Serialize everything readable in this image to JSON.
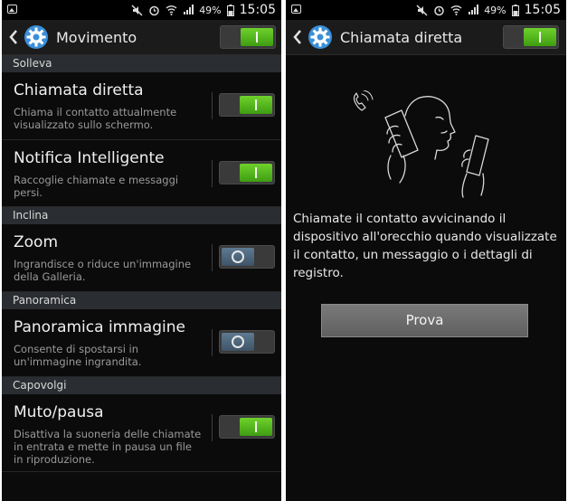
{
  "status_bar": {
    "battery_percent": "49%",
    "time": "15:05"
  },
  "left_screen": {
    "title": "Movimento",
    "master_switch_on": true,
    "sections": [
      {
        "header": "Solleva",
        "items": [
          {
            "title": "Chiamata diretta",
            "description": "Chiama il contatto attualmente visualizzato sullo schermo.",
            "on": true
          },
          {
            "title": "Notifica Intelligente",
            "description": "Raccoglie chiamate e messaggi persi.",
            "on": true
          }
        ]
      },
      {
        "header": "Inclina",
        "items": [
          {
            "title": "Zoom",
            "description": "Ingrandisce o riduce un'immagine della Galleria.",
            "on": false
          }
        ]
      },
      {
        "header": "Panoramica",
        "items": [
          {
            "title": "Panoramica immagine",
            "description": "Consente di spostarsi in un'immagine ingrandita.",
            "on": false
          }
        ]
      },
      {
        "header": "Capovolgi",
        "items": [
          {
            "title": "Muto/pausa",
            "description": "Disattiva la suoneria delle chiamate in entrata e mette in pausa un file in riproduzione.",
            "on": true
          }
        ]
      }
    ]
  },
  "right_screen": {
    "title": "Chiamata diretta",
    "master_switch_on": true,
    "description": "Chiamate il contatto avvicinando il dispositivo all'orecchio quando visualizzate il contatto, un messaggio o i dettagli di registro.",
    "button_label": "Prova"
  },
  "colors": {
    "switch_on": "#4caf1a",
    "switch_off": "#4e6478",
    "section_bg": "#2a2d31",
    "gear": "#3a8fd8"
  }
}
